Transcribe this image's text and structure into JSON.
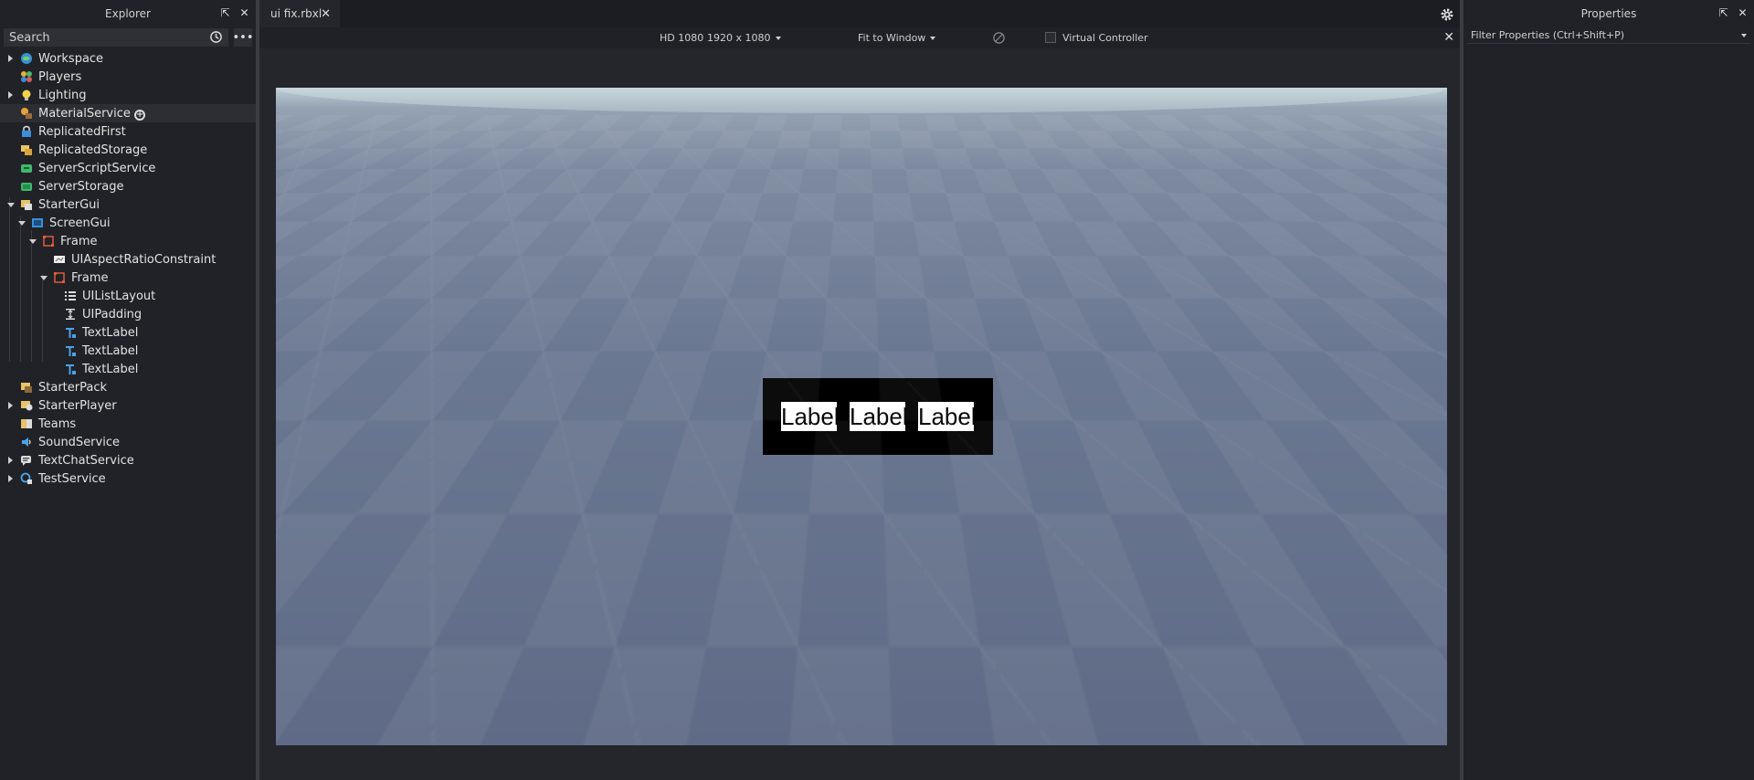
{
  "explorer": {
    "title": "Explorer",
    "search_placeholder": "Search",
    "more_label": "•••",
    "items": [
      {
        "label": "Workspace",
        "icon": "workspace-icon"
      },
      {
        "label": "Players",
        "icon": "players-icon"
      },
      {
        "label": "Lighting",
        "icon": "lighting-icon"
      },
      {
        "label": "MaterialService",
        "icon": "material-service-icon"
      },
      {
        "label": "ReplicatedFirst",
        "icon": "replicated-first-icon"
      },
      {
        "label": "ReplicatedStorage",
        "icon": "replicated-storage-icon"
      },
      {
        "label": "ServerScriptService",
        "icon": "server-script-service-icon"
      },
      {
        "label": "ServerStorage",
        "icon": "server-storage-icon"
      },
      {
        "label": "StarterGui",
        "icon": "starter-gui-icon"
      },
      {
        "label": "ScreenGui",
        "icon": "screen-gui-icon"
      },
      {
        "label": "Frame",
        "icon": "frame-icon"
      },
      {
        "label": "UIAspectRatioConstraint",
        "icon": "aspect-ratio-icon"
      },
      {
        "label": "Frame",
        "icon": "frame-icon"
      },
      {
        "label": "UIListLayout",
        "icon": "list-layout-icon"
      },
      {
        "label": "UIPadding",
        "icon": "padding-icon"
      },
      {
        "label": "TextLabel",
        "icon": "text-label-icon"
      },
      {
        "label": "TextLabel",
        "icon": "text-label-icon"
      },
      {
        "label": "TextLabel",
        "icon": "text-label-icon"
      },
      {
        "label": "StarterPack",
        "icon": "starter-pack-icon"
      },
      {
        "label": "StarterPlayer",
        "icon": "starter-player-icon"
      },
      {
        "label": "Teams",
        "icon": "teams-icon"
      },
      {
        "label": "SoundService",
        "icon": "sound-service-icon"
      },
      {
        "label": "TextChatService",
        "icon": "text-chat-service-icon"
      },
      {
        "label": "TestService",
        "icon": "test-service-icon"
      }
    ]
  },
  "editor": {
    "tab_label": "ui fix.rbxl",
    "device": "HD 1080",
    "resolution": "1920 x 1080",
    "fit": "Fit to Window",
    "virtual_controller": "Virtual Controller",
    "labels": [
      "Label",
      "Label",
      "Label"
    ]
  },
  "properties": {
    "title": "Properties",
    "filter_placeholder": "Filter Properties (Ctrl+Shift+P)"
  },
  "colors": {
    "panel_bg": "#202227",
    "viewport_frame": "#000000",
    "label_bg": "#ffffff"
  }
}
